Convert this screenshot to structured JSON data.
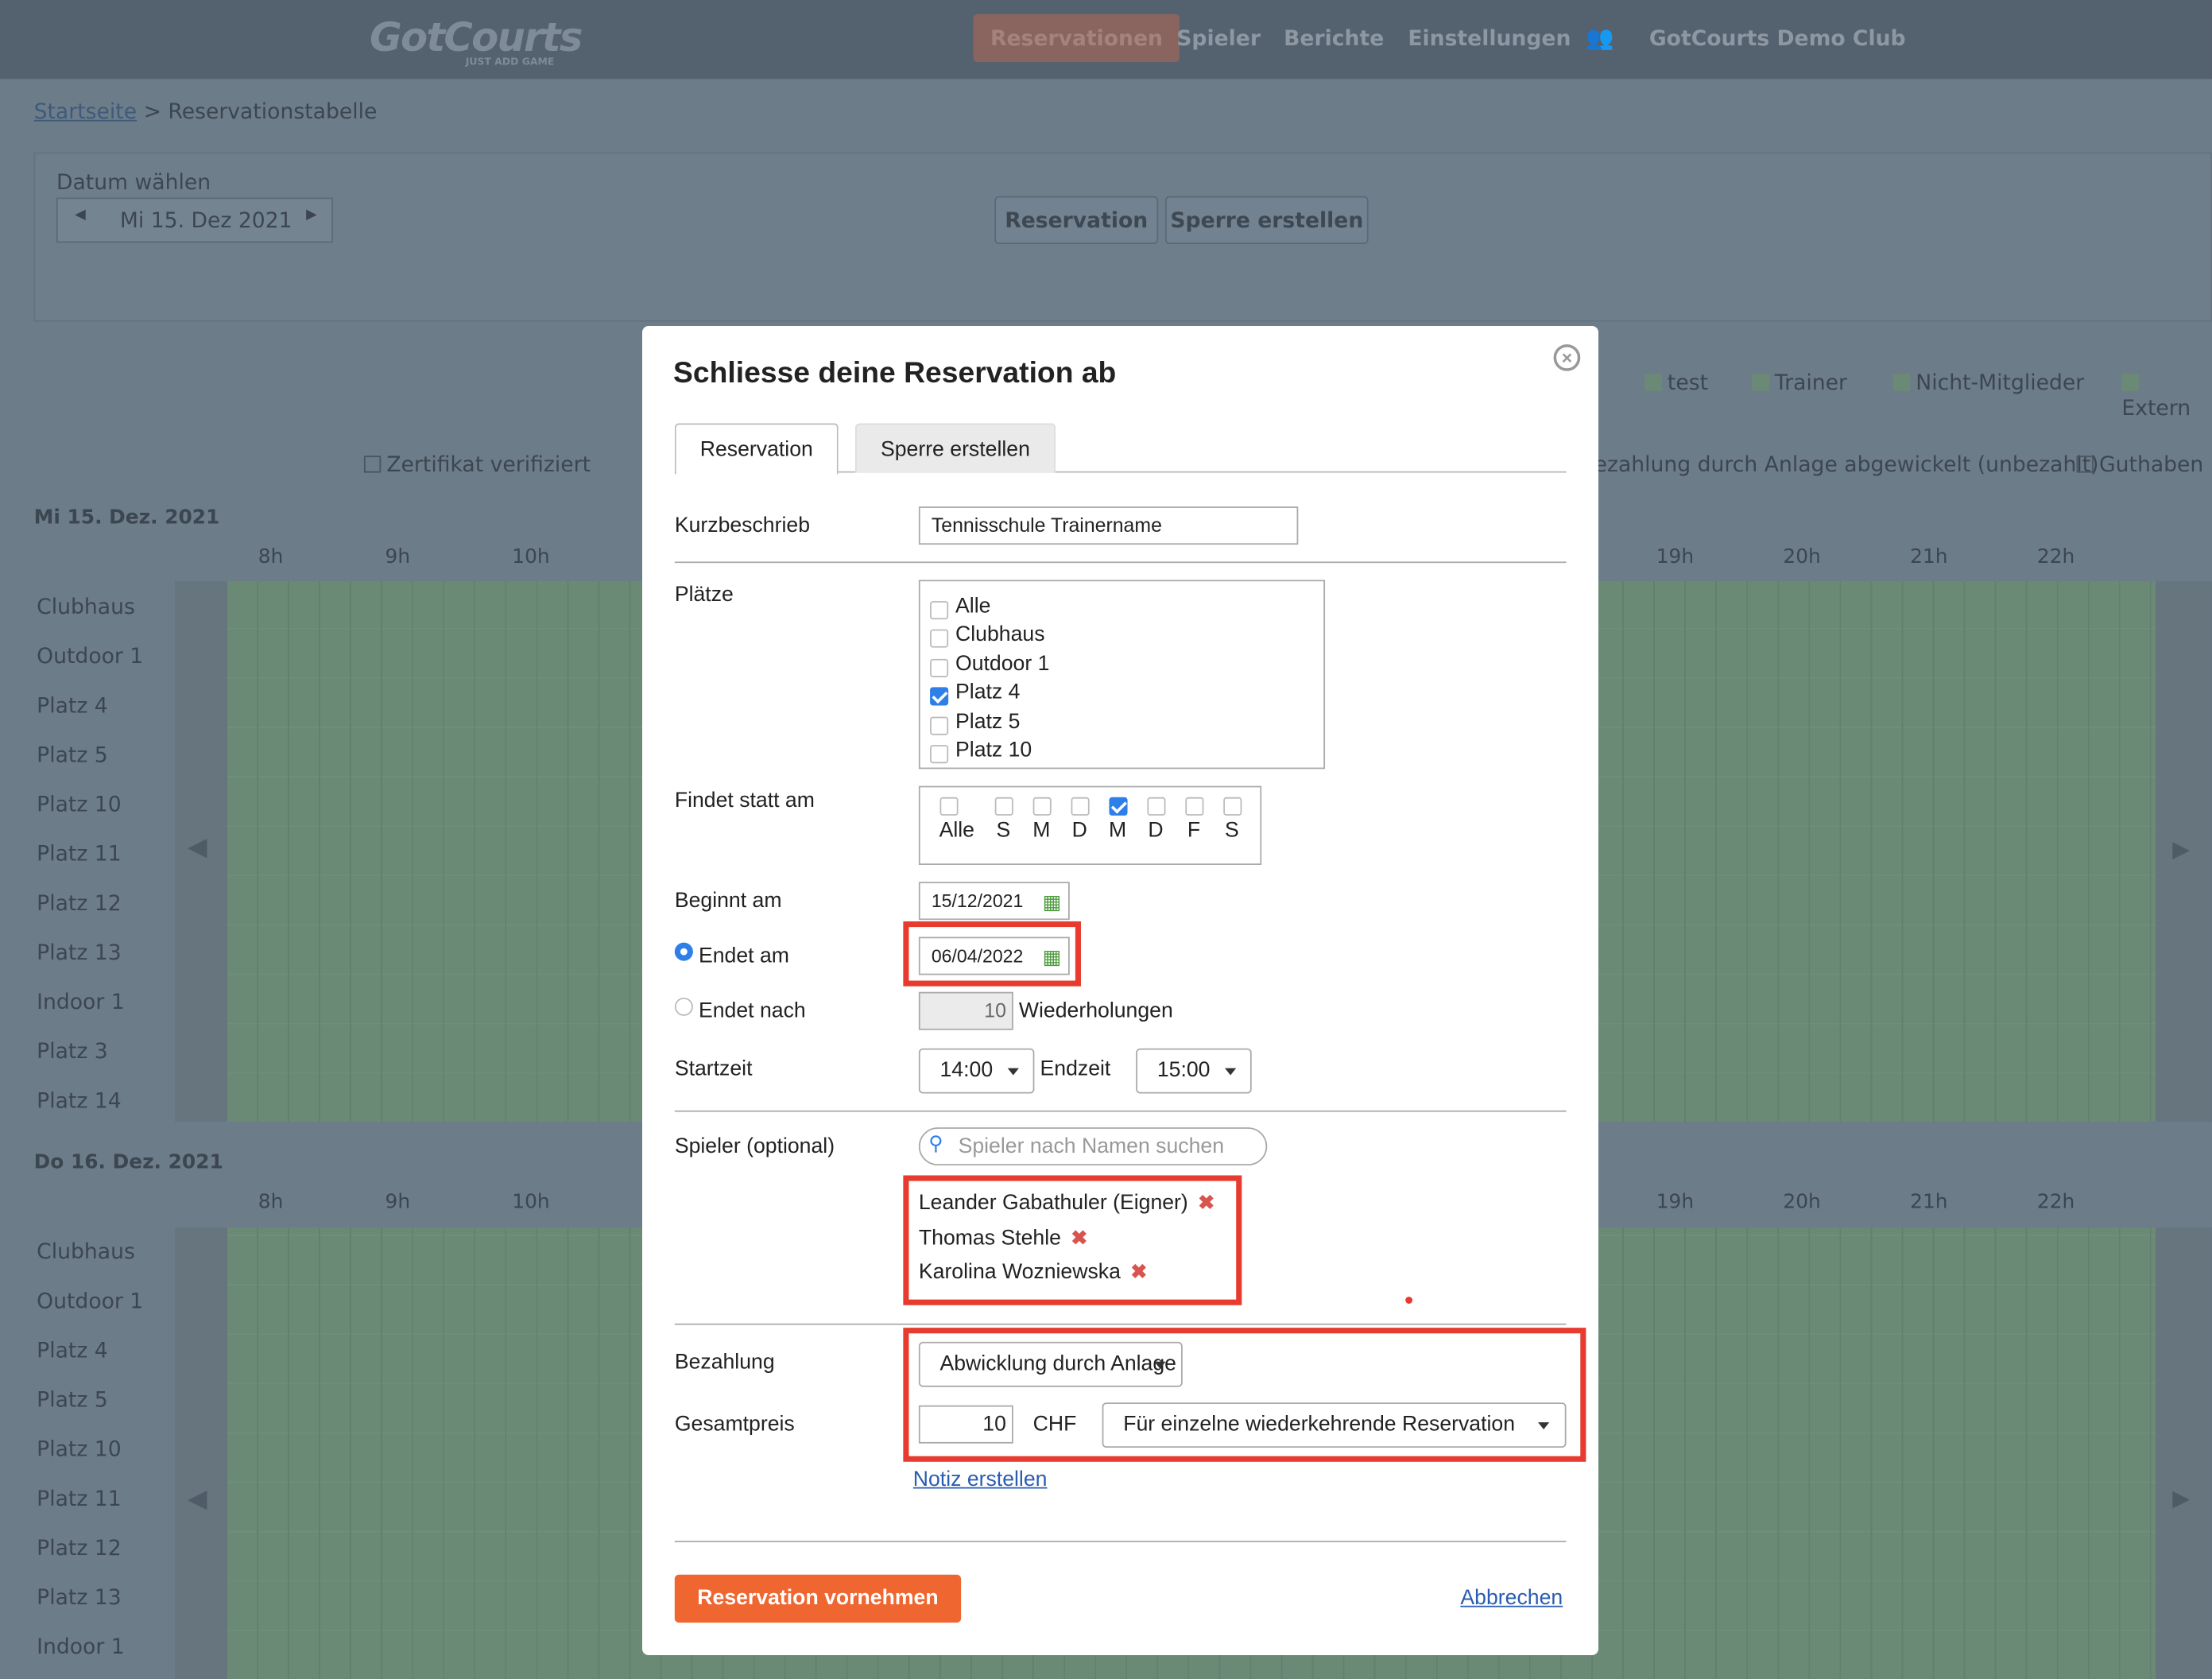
{
  "app": {
    "logo": "GotCourts",
    "logo_tagline": "JUST ADD GAME",
    "nav": [
      "Reservationen",
      "Spieler",
      "Berichte",
      "Einstellungen",
      "GotCourts Demo Club"
    ],
    "nav_active": "Reservationen"
  },
  "breadcrumb": {
    "home": "Startseite",
    "separator": ">",
    "current": "Reservationstabelle"
  },
  "toolbar": {
    "date_label": "Datum wählen",
    "date_value": "Mi 15. Dez 2021",
    "reservation_button": "Reservation",
    "block_button": "Sperre erstellen"
  },
  "legend": {
    "items": [
      "test",
      "Trainer",
      "Nicht-Mitglieder",
      "Extern"
    ],
    "certificate": "Zertifikat verifiziert",
    "payment": "ezahlung durch Anlage abgewickelt (unbezahlt)",
    "credit": "Guthaben"
  },
  "schedule": {
    "day1": "Mi 15. Dez. 2021",
    "day2": "Do 16. Dez. 2021",
    "hours_left": [
      "8h",
      "9h",
      "10h"
    ],
    "hours_right": [
      "19h",
      "20h",
      "21h",
      "22h"
    ],
    "courts1": [
      "Clubhaus",
      "Outdoor 1",
      "Platz 4",
      "Platz 5",
      "Platz 10",
      "Platz 11",
      "Platz 12",
      "Platz 13",
      "Indoor 1",
      "Platz 3",
      "Platz 14"
    ],
    "courts2": [
      "Clubhaus",
      "Outdoor 1",
      "Platz 4",
      "Platz 5",
      "Platz 10",
      "Platz 11",
      "Platz 12",
      "Platz 13",
      "Indoor 1"
    ]
  },
  "modal": {
    "title": "Schliesse deine Reservation ab",
    "close_icon": "close-icon",
    "tabs": [
      "Reservation",
      "Sperre erstellen"
    ],
    "kurzbeschrieb_label": "Kurzbeschrieb",
    "kurzbeschrieb_value": "Tennisschule Trainername",
    "plaetze_label": "Plätze",
    "courts": [
      {
        "name": "Alle",
        "checked": false
      },
      {
        "name": "Clubhaus",
        "checked": false
      },
      {
        "name": "Outdoor 1",
        "checked": false
      },
      {
        "name": "Platz 4",
        "checked": true
      },
      {
        "name": "Platz 5",
        "checked": false
      },
      {
        "name": "Platz 10",
        "checked": false
      }
    ],
    "findet_label": "Findet statt am",
    "days": [
      {
        "name": "Alle",
        "checked": false
      },
      {
        "name": "S",
        "checked": false
      },
      {
        "name": "M",
        "checked": false
      },
      {
        "name": "D",
        "checked": false
      },
      {
        "name": "M",
        "checked": true
      },
      {
        "name": "D",
        "checked": false
      },
      {
        "name": "F",
        "checked": false
      },
      {
        "name": "S",
        "checked": false
      }
    ],
    "beginnt_label": "Beginnt am",
    "beginnt_value": "15/12/2021",
    "endet_am_label": "Endet am",
    "endet_am_value": "06/04/2022",
    "endet_nach_label": "Endet nach",
    "endet_nach_value": "10",
    "wiederholungen": "Wiederholungen",
    "startzeit_label": "Startzeit",
    "startzeit_value": "14:00",
    "endzeit_label": "Endzeit",
    "endzeit_value": "15:00",
    "spieler_label": "Spieler (optional)",
    "spieler_placeholder": "Spieler nach Namen suchen",
    "players": [
      "Leander Gabathuler (Eigner)",
      "Thomas Stehle",
      "Karolina Wozniewska"
    ],
    "bezahlung_label": "Bezahlung",
    "bezahlung_value": "Abwicklung durch Anlage",
    "gesamtpreis_label": "Gesamtpreis",
    "gesamtpreis_value": "10",
    "currency": "CHF",
    "price_scope": "Für einzelne wiederkehrende Reservation",
    "note_link": "Notiz erstellen",
    "submit": "Reservation vornehmen",
    "cancel": "Abbrechen"
  },
  "colors": {
    "accent": "#ef6630",
    "highlight": "#e63b2e",
    "check": "#2f7fe8"
  }
}
